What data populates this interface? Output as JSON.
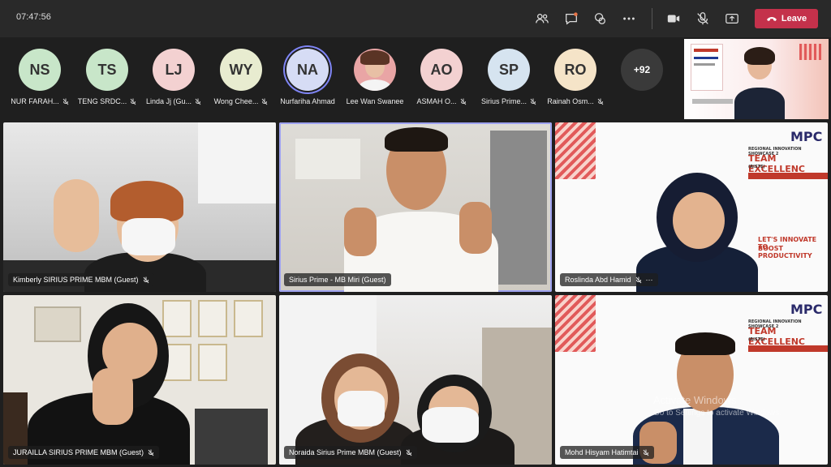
{
  "topbar": {
    "time": "07:47:56",
    "leave_label": "Leave",
    "icons": [
      "people-icon",
      "chat-icon",
      "reactions-icon",
      "more-options-icon",
      "camera-icon",
      "mic-off-icon",
      "share-screen-icon"
    ]
  },
  "roster": {
    "people": [
      {
        "initials": "NS",
        "name": "NUR FARAH...",
        "color": "#c8e6c9",
        "muted": true
      },
      {
        "initials": "TS",
        "name": "TENG SRDC...",
        "color": "#c8e6c9",
        "muted": true
      },
      {
        "initials": "LJ",
        "name": "Linda Jj (Gu...",
        "color": "#f3d1d1",
        "muted": true
      },
      {
        "initials": "WY",
        "name": "Wong Chee...",
        "color": "#e8ecd0",
        "muted": true
      },
      {
        "initials": "NA",
        "name": "Nurfariha Ahmad",
        "color": "#d6dcf5",
        "muted": false
      },
      {
        "initials": "",
        "name": "Lee Wan Swanee",
        "color": "#e9a5a5",
        "muted": false
      },
      {
        "initials": "AO",
        "name": "ASMAH O...",
        "color": "#f3d1d1",
        "muted": true
      },
      {
        "initials": "SP",
        "name": "Sirius Prime...",
        "color": "#d6e4f0",
        "muted": true
      },
      {
        "initials": "RO",
        "name": "Rainah Osm...",
        "color": "#f5e4c8",
        "muted": true
      }
    ],
    "more_count": "+92"
  },
  "tiles": [
    {
      "name": "Kimberly SIRIUS PRIME MBM (Guest)",
      "muted": true
    },
    {
      "name": "Sirius Prime - MB Miri (Guest)",
      "muted": false
    },
    {
      "name": "Roslinda Abd Hamid",
      "muted": true,
      "more": "···"
    },
    {
      "name": "JURAILLA SIRIUS PRIME MBM (Guest)",
      "muted": true
    },
    {
      "name": "Noraida Sirius Prime MBM (Guest)",
      "muted": true
    },
    {
      "name": "Mohd Hisyam Hatimtai",
      "muted": true
    }
  ],
  "poster": {
    "logo": "MPC",
    "line1": "REGIONAL INNOVATION SHOWCASE 2",
    "line2": "TEAM EXCELLENC",
    "line3": "(RISTE)",
    "line4": "LET'S INNOVATE TO",
    "line5": "BOOST PRODUCTIVITY"
  },
  "watermark": {
    "title": "Activate Windows",
    "subtitle": "Go to Settings to activate Windows."
  },
  "colors": {
    "leave": "#c4314b",
    "active_outline": "#9ea2f0",
    "topbar": "#292929"
  }
}
